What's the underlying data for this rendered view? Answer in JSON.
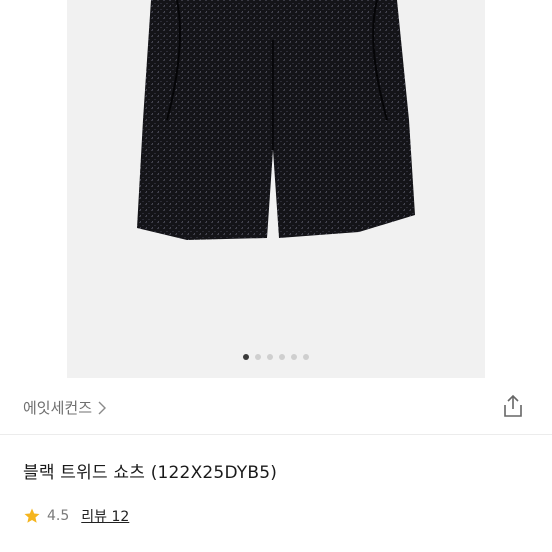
{
  "product": {
    "brand": "에잇세컨즈",
    "title": "블랙 트위드 쇼츠 (122X25DYB5)",
    "rating": "4.5",
    "reviews_label": "리뷰 12"
  },
  "gallery": {
    "image": "black-tweed-shorts-photo",
    "total_images": 6,
    "active_index": 0
  },
  "icons": {
    "brand_arrow": "chevron-right-icon",
    "share": "share-icon",
    "rating": "star-icon"
  },
  "colors": {
    "star": "#f5b51f",
    "gallery_bg": "#f1f1f1",
    "active_dot": "#3a3a3a"
  }
}
